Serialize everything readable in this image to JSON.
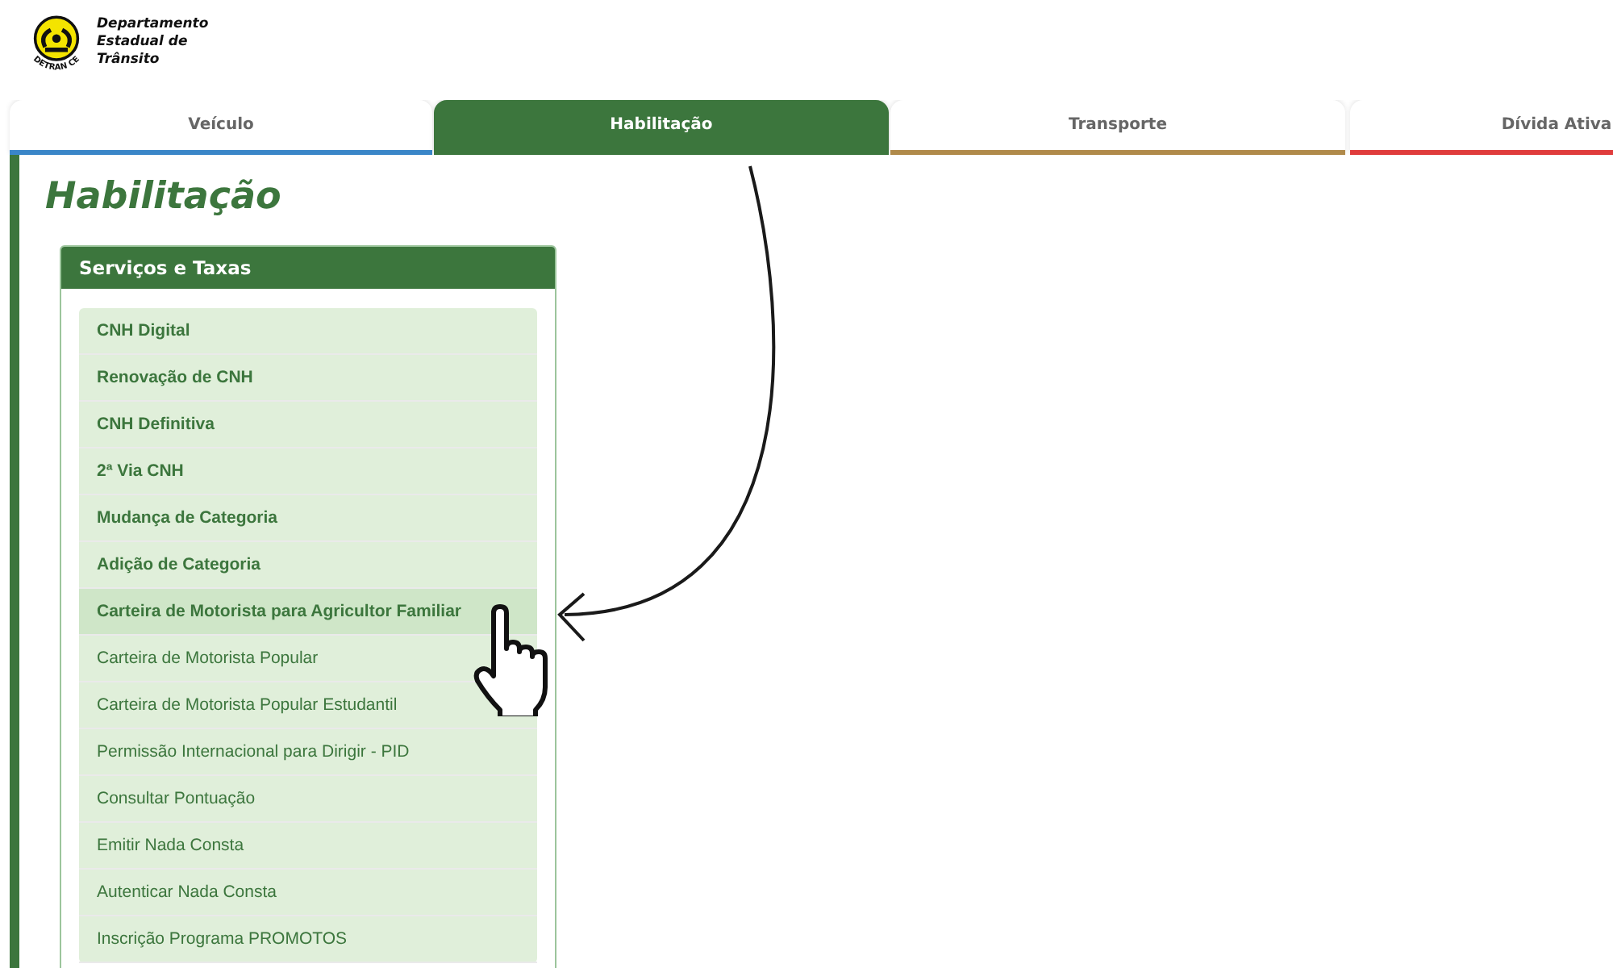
{
  "logo": {
    "name_lines": [
      "Departamento",
      "Estadual de",
      "Trânsito"
    ],
    "ring_text": "DETRAN CE"
  },
  "tabs": [
    {
      "label": "Veículo",
      "selected": false,
      "color": "#3a86c8"
    },
    {
      "label": "Habilitação",
      "selected": true,
      "color": "#3c763d"
    },
    {
      "label": "Transporte",
      "selected": false,
      "color": "#b08a4a"
    },
    {
      "label": "Dívida Ativa",
      "selected": false,
      "color": "#e03c3c"
    }
  ],
  "page_title": "Habilitação",
  "panel": {
    "title": "Serviços e Taxas",
    "items": [
      {
        "label": "CNH Digital",
        "bold": true,
        "selected": false
      },
      {
        "label": "Renovação de CNH",
        "bold": true,
        "selected": false
      },
      {
        "label": "CNH Definitiva",
        "bold": true,
        "selected": false
      },
      {
        "label": "2ª Via CNH",
        "bold": true,
        "selected": false
      },
      {
        "label": "Mudança de Categoria",
        "bold": true,
        "selected": false
      },
      {
        "label": "Adição de Categoria",
        "bold": true,
        "selected": false
      },
      {
        "label": "Carteira de Motorista para Agricultor Familiar",
        "bold": true,
        "selected": true
      },
      {
        "label": "Carteira de Motorista Popular",
        "bold": false,
        "selected": false
      },
      {
        "label": "Carteira de Motorista Popular Estudantil",
        "bold": false,
        "selected": false
      },
      {
        "label": "Permissão Internacional para Dirigir - PID",
        "bold": false,
        "selected": false
      },
      {
        "label": "Consultar Pontuação",
        "bold": false,
        "selected": false
      },
      {
        "label": "Emitir Nada Consta",
        "bold": false,
        "selected": false
      },
      {
        "label": "Autenticar Nada Consta",
        "bold": false,
        "selected": false
      },
      {
        "label": "Inscrição Programa PROMOTOS",
        "bold": false,
        "selected": false
      }
    ]
  }
}
